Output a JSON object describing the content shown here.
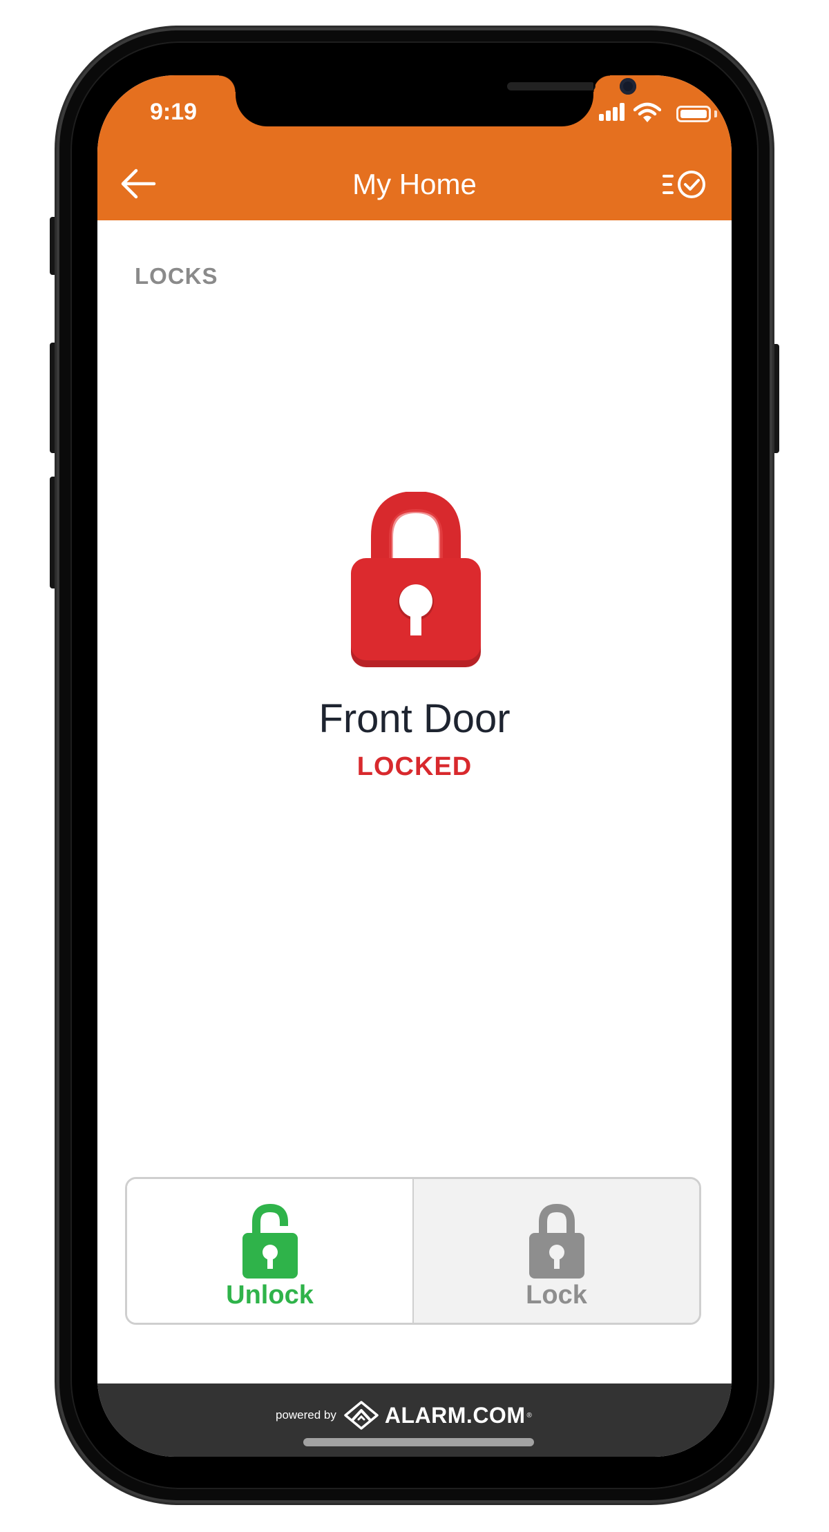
{
  "status_bar": {
    "time": "9:19"
  },
  "nav": {
    "title": "My Home",
    "back_icon": "arrow-left-icon",
    "history_icon": "list-check-icon"
  },
  "section": {
    "label": "LOCKS"
  },
  "device": {
    "name": "Front Door",
    "status": "LOCKED",
    "icon": "padlock-locked-icon"
  },
  "actions": {
    "unlock_label": "Unlock",
    "lock_label": "Lock"
  },
  "footer": {
    "powered_by": "powered by",
    "brand": "ALARM.COM",
    "registered": "®"
  },
  "colors": {
    "header": "#e5701f",
    "locked": "#d8292d",
    "unlock": "#2fb34a",
    "lock_disabled": "#8e8e8e",
    "footer": "#333333"
  }
}
